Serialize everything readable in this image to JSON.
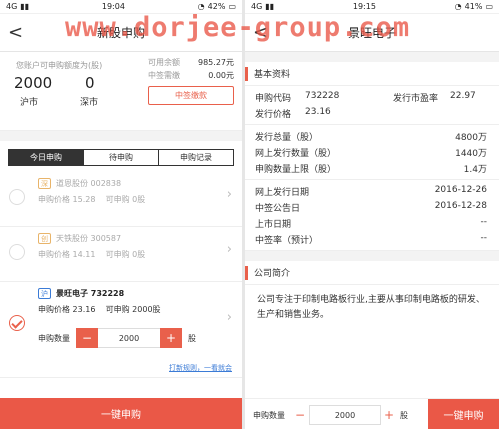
{
  "watermark": "www.dorjee-group.com",
  "left": {
    "status": {
      "carrier": "4G",
      "time": "19:04",
      "battery": "42%"
    },
    "nav": {
      "back": "<",
      "title": "新股申购"
    },
    "account": {
      "quota_label": "您账户可申购额度为(股)",
      "sh_value": "2000",
      "sh_label": "沪市",
      "sz_value": "0",
      "sz_label": "深市",
      "balance_label": "可用余额",
      "balance_value": "985.27元",
      "need_label": "中签需缴",
      "need_value": "0.00元",
      "pay_button": "中签缴款"
    },
    "tabs": [
      "今日申购",
      "待申购",
      "申购记录"
    ],
    "stocks": [
      {
        "badge": "深",
        "name": "道恩股份 002838",
        "price_label": "申购价格",
        "price": "15.28",
        "qty_label": "可申购",
        "qty": "0股"
      },
      {
        "badge": "创",
        "name": "天铁股份 300587",
        "price_label": "申购价格",
        "price": "14.11",
        "qty_label": "可申购",
        "qty": "0股"
      },
      {
        "badge": "沪",
        "name": "景旺电子 732228",
        "price_label": "申购价格",
        "price": "23.16",
        "qty_label": "可申购",
        "qty": "2000股"
      }
    ],
    "stepper": {
      "label": "申购数量",
      "minus": "−",
      "value": "2000",
      "plus": "+",
      "unit": "股"
    },
    "rule_link": "打新规则，一看就会",
    "submit": "一键申购"
  },
  "right": {
    "status": {
      "carrier": "4G",
      "time": "19:15",
      "battery": "41%"
    },
    "nav": {
      "back": "<",
      "title": "景旺电子"
    },
    "basic_title": "基本资料",
    "code_label": "申购代码",
    "code_value": "732228",
    "pe_label": "发行市盈率",
    "pe_value": "22.97",
    "price_label": "发行价格",
    "price_value": "23.16",
    "rows1": [
      {
        "k": "发行总量（股）",
        "v": "4800万"
      },
      {
        "k": "网上发行数量（股）",
        "v": "1440万"
      },
      {
        "k": "申购数量上限（股）",
        "v": "1.4万"
      }
    ],
    "rows2": [
      {
        "k": "网上发行日期",
        "v": "2016-12-26"
      },
      {
        "k": "中签公告日",
        "v": "2016-12-28"
      },
      {
        "k": "上市日期",
        "v": "--"
      },
      {
        "k": "中签率（预计）",
        "v": "--"
      }
    ],
    "intro_title": "公司简介",
    "intro_text": "公司专注于印制电路板行业,主要从事印制电路板的研发、生产和销售业务。",
    "bottom": {
      "label": "申购数量",
      "minus": "−",
      "value": "2000",
      "plus": "+",
      "unit": "股",
      "buy": "一键申购"
    }
  }
}
